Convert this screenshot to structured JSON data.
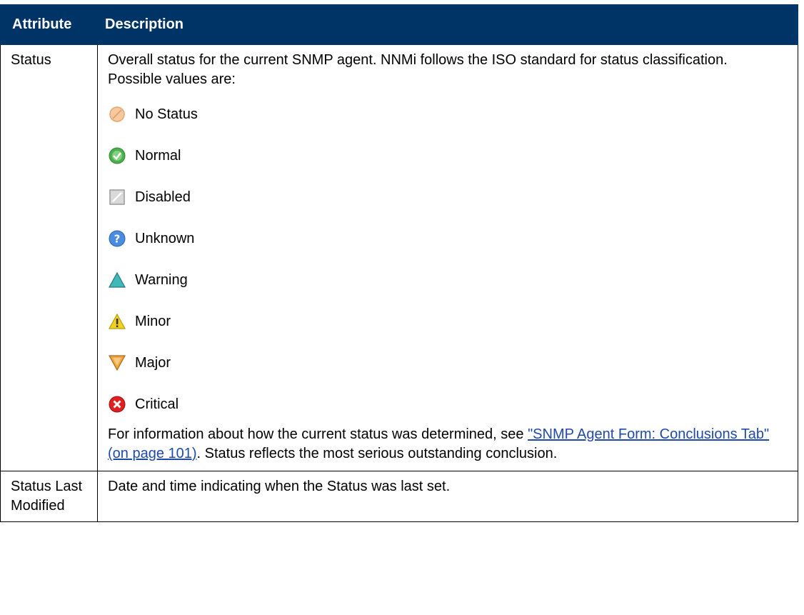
{
  "header": {
    "col1": "Attribute",
    "col2": "Description"
  },
  "rows": [
    {
      "attribute": "Status",
      "intro": "Overall status for the current SNMP agent. NNMi follows the ISO standard for status classification. Possible values are:",
      "statuses": [
        {
          "label": "No Status",
          "icon": "no-status-icon"
        },
        {
          "label": "Normal",
          "icon": "normal-icon"
        },
        {
          "label": "Disabled",
          "icon": "disabled-icon"
        },
        {
          "label": "Unknown",
          "icon": "unknown-icon"
        },
        {
          "label": "Warning",
          "icon": "warning-icon"
        },
        {
          "label": "Minor",
          "icon": "minor-icon"
        },
        {
          "label": "Major",
          "icon": "major-icon"
        },
        {
          "label": "Critical",
          "icon": "critical-icon"
        }
      ],
      "info_prefix": "For information about how the current status was determined, see ",
      "info_link": "\"SNMP Agent Form: Conclusions Tab\" (on page 101)",
      "info_suffix": ". Status reflects the most serious outstanding conclusion."
    },
    {
      "attribute": "Status Last Modified",
      "description": "Date and time indicating when the Status was last set."
    }
  ]
}
